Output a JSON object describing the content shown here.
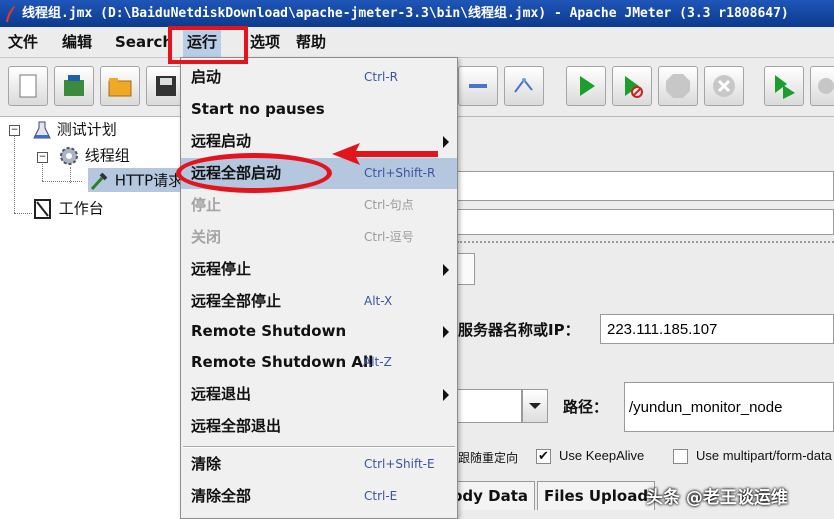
{
  "window": {
    "title": "线程组.jmx (D:\\BaiduNetdiskDownload\\apache-jmeter-3.3\\bin\\线程组.jmx) - Apache JMeter (3.3 r1808647)"
  },
  "menubar": {
    "items": [
      {
        "label": "文件"
      },
      {
        "label": "编辑"
      },
      {
        "label": "Search"
      },
      {
        "label": "运行"
      },
      {
        "label": "选项"
      },
      {
        "label": "帮助"
      }
    ]
  },
  "tree": {
    "nodes": [
      {
        "label": "测试计划"
      },
      {
        "label": "线程组"
      },
      {
        "label": "HTTP请求"
      },
      {
        "label": "工作台"
      }
    ]
  },
  "run_menu": {
    "items": [
      {
        "label": "启动",
        "accel": "Ctrl-R"
      },
      {
        "label": "Start no pauses",
        "accel": ""
      },
      {
        "label": "远程启动",
        "accel": ""
      },
      {
        "label": "远程全部启动",
        "accel": "Ctrl+Shift-R"
      },
      {
        "label": "停止",
        "accel": "Ctrl-句点"
      },
      {
        "label": "关闭",
        "accel": "Ctrl-逗号"
      },
      {
        "label": "远程停止",
        "accel": ""
      },
      {
        "label": "远程全部停止",
        "accel": "Alt-X"
      },
      {
        "label": "Remote Shutdown",
        "accel": ""
      },
      {
        "label": "Remote Shutdown All",
        "accel": "Alt-Z"
      },
      {
        "label": "远程退出",
        "accel": ""
      },
      {
        "label": "远程全部退出",
        "accel": ""
      },
      {
        "label": "清除",
        "accel": "Ctrl+Shift-E"
      },
      {
        "label": "清除全部",
        "accel": "Ctrl-E"
      }
    ]
  },
  "http_panel": {
    "server_label": "服务器名称或IP：",
    "server_value": "223.111.185.107",
    "path_label": "路径：",
    "path_value": "/yundun_monitor_node",
    "follow_redirects_label": "跟随重定向",
    "keepalive_label": "Use KeepAlive",
    "keepalive_checked": "✔",
    "multipart_label": "Use multipart/form-data",
    "tabs": [
      {
        "label": "Body Data"
      },
      {
        "label": "Files Upload"
      }
    ]
  },
  "watermark": "头条 @老王谈运维",
  "colors": {
    "highlight": "#b4c7df",
    "annotation_red": "#e3141c",
    "title_bar": "#0c3a8e"
  }
}
